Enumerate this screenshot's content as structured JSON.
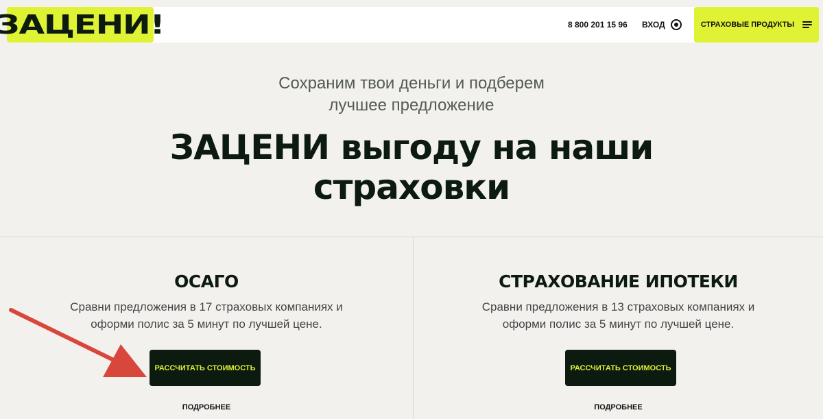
{
  "header": {
    "logo_text": "ЗАЦЕНИ!",
    "phone": "8 800 201 15 96",
    "login_label": "ВХОД",
    "products_label": "СТРАХОВЫЕ ПРОДУКТЫ"
  },
  "hero": {
    "subtitle_line1": "Сохраним твои деньги и подберем",
    "subtitle_line2": "лучшее предложение",
    "title_line1": "ЗАЦЕНИ выгоду на наши",
    "title_line2": "страховки"
  },
  "cards": [
    {
      "title": "ОСАГО",
      "desc_line1": "Сравни предложения в 17 страховых компаниях и",
      "desc_line2": "оформи полис за 5 минут по лучшей цене.",
      "button_label": "РАССЧИТАТЬ СТОИМОСТЬ",
      "more_label": "ПОДРОБНЕЕ"
    },
    {
      "title": "СТРАХОВАНИЕ ИПОТЕКИ",
      "desc_line1": "Сравни предложения в 13 страховых компаниях и",
      "desc_line2": "оформи полис за 5 минут по лучшей цене.",
      "button_label": "РАССЧИТАТЬ СТОИМОСТЬ",
      "more_label": "ПОДРОБНЕЕ"
    }
  ],
  "colors": {
    "accent": "#dff233",
    "dark": "#0c1a10",
    "background": "#f2f1ee",
    "annotation_arrow": "#d9463c"
  }
}
